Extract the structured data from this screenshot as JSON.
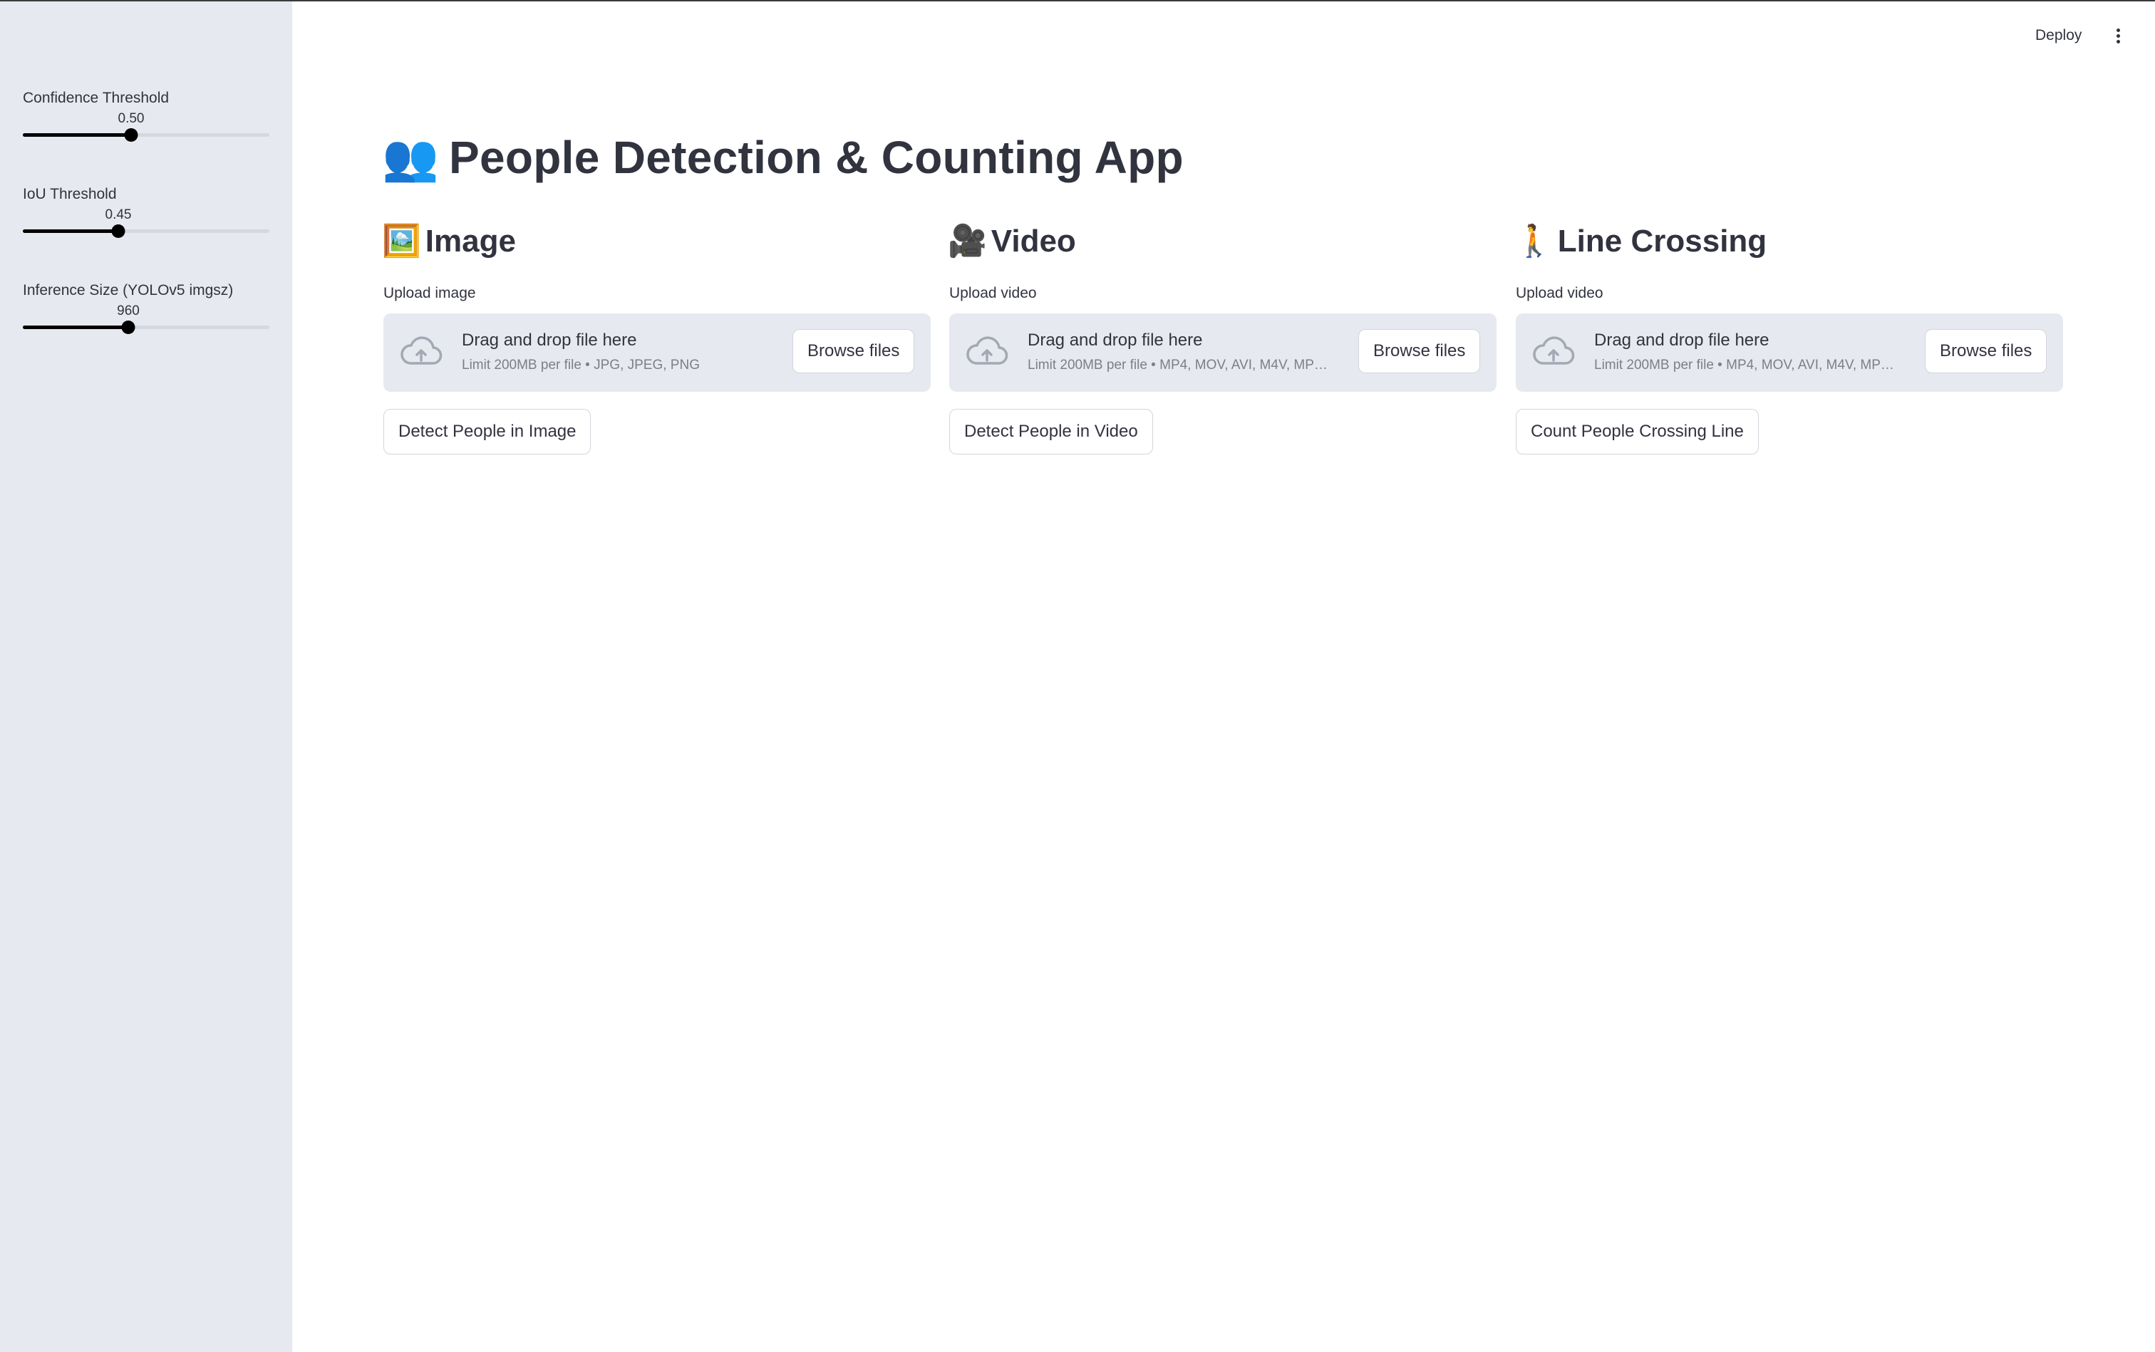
{
  "header": {
    "deploy_label": "Deploy",
    "menu_icon": "more-vertical-icon"
  },
  "sidebar": {
    "sliders": [
      {
        "label": "Confidence Threshold",
        "value": "0.50",
        "level": 0.5
      },
      {
        "label": "IoU Threshold",
        "value": "0.45",
        "level": 0.39
      },
      {
        "label": "Inference Size (YOLOv5 imgsz)",
        "value": "960",
        "level": 0.43
      }
    ]
  },
  "main": {
    "title_emoji": "👥",
    "title": "People Detection & Counting App",
    "columns": [
      {
        "emoji": "🖼️",
        "heading": "Image",
        "upload_label": "Upload image",
        "drop_title": "Drag and drop file here",
        "drop_limit": "Limit 200MB per file • JPG, JPEG, PNG",
        "browse_label": "Browse files",
        "action_label": "Detect People in Image"
      },
      {
        "emoji": "🎥",
        "heading": "Video",
        "upload_label": "Upload video",
        "drop_title": "Drag and drop file here",
        "drop_limit": "Limit 200MB per file • MP4, MOV, AVI, M4V, MP…",
        "browse_label": "Browse files",
        "action_label": "Detect People in Video"
      },
      {
        "emoji": "🚶",
        "heading": "Line Crossing",
        "upload_label": "Upload video",
        "drop_title": "Drag and drop file here",
        "drop_limit": "Limit 200MB per file • MP4, MOV, AVI, M4V, MP…",
        "browse_label": "Browse files",
        "action_label": "Count People Crossing Line"
      }
    ]
  },
  "colors": {
    "sidebar_bg": "#e6e9ef",
    "text": "#31333f",
    "muted": "#7d7f86",
    "slider_active": "#000000"
  }
}
